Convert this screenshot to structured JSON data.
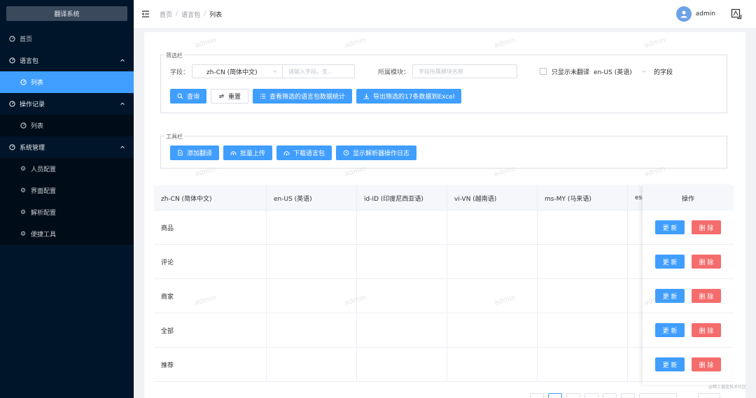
{
  "sidebar": {
    "title": "翻译系统",
    "items": [
      {
        "label": "首页",
        "type": "top"
      },
      {
        "label": "语言包",
        "type": "group"
      },
      {
        "label": "列表",
        "type": "active"
      },
      {
        "label": "操作记录",
        "type": "group"
      },
      {
        "label": "列表",
        "type": "sub"
      },
      {
        "label": "系统管理",
        "type": "group"
      },
      {
        "label": "人员配置",
        "type": "tool"
      },
      {
        "label": "界面配置",
        "type": "tool"
      },
      {
        "label": "解析配置",
        "type": "tool"
      },
      {
        "label": "便捷工具",
        "type": "tool"
      }
    ]
  },
  "header": {
    "breadcrumb": [
      "首页",
      "语言包",
      "列表"
    ],
    "username": "admin"
  },
  "filter": {
    "legend": "筛选栏",
    "field_label": "字段：",
    "field_value": "zh-CN (简体中文)",
    "field_placeholder": "请输入字段。支...",
    "module_label": "所属模块：",
    "module_placeholder": "字段所属模块名称",
    "only_untranslated": "只显示未翻译",
    "lang_value": "en-US (英语)",
    "suffix": "的字段",
    "buttons": {
      "query": "查询",
      "reset": "重置",
      "stats": "查看筛选的语言包数据统计",
      "export": "导出筛选的17条数据到Excel"
    }
  },
  "toolbar": {
    "legend": "工具栏",
    "buttons": {
      "add": "添加翻译",
      "upload": "批量上传",
      "download": "下载语言包",
      "log": "显示解析器操作日志"
    }
  },
  "table": {
    "headers": [
      "zh-CN (简体中文)",
      "en-US (英语)",
      "id-ID (印度尼西亚语)",
      "vi-VN (越南语)",
      "ms-MY (马来语)",
      "es-"
    ],
    "ops_header": "操作",
    "rows": [
      "商品",
      "评论",
      "商家",
      "全部",
      "推荐"
    ],
    "update_label": "更 新",
    "delete_label": "删 除"
  },
  "watermark": "admin",
  "footer_note": "@稀土掘金技术社区",
  "colors": {
    "primary": "#409eff",
    "danger": "#f56c6c",
    "sidebar": "#001529"
  }
}
